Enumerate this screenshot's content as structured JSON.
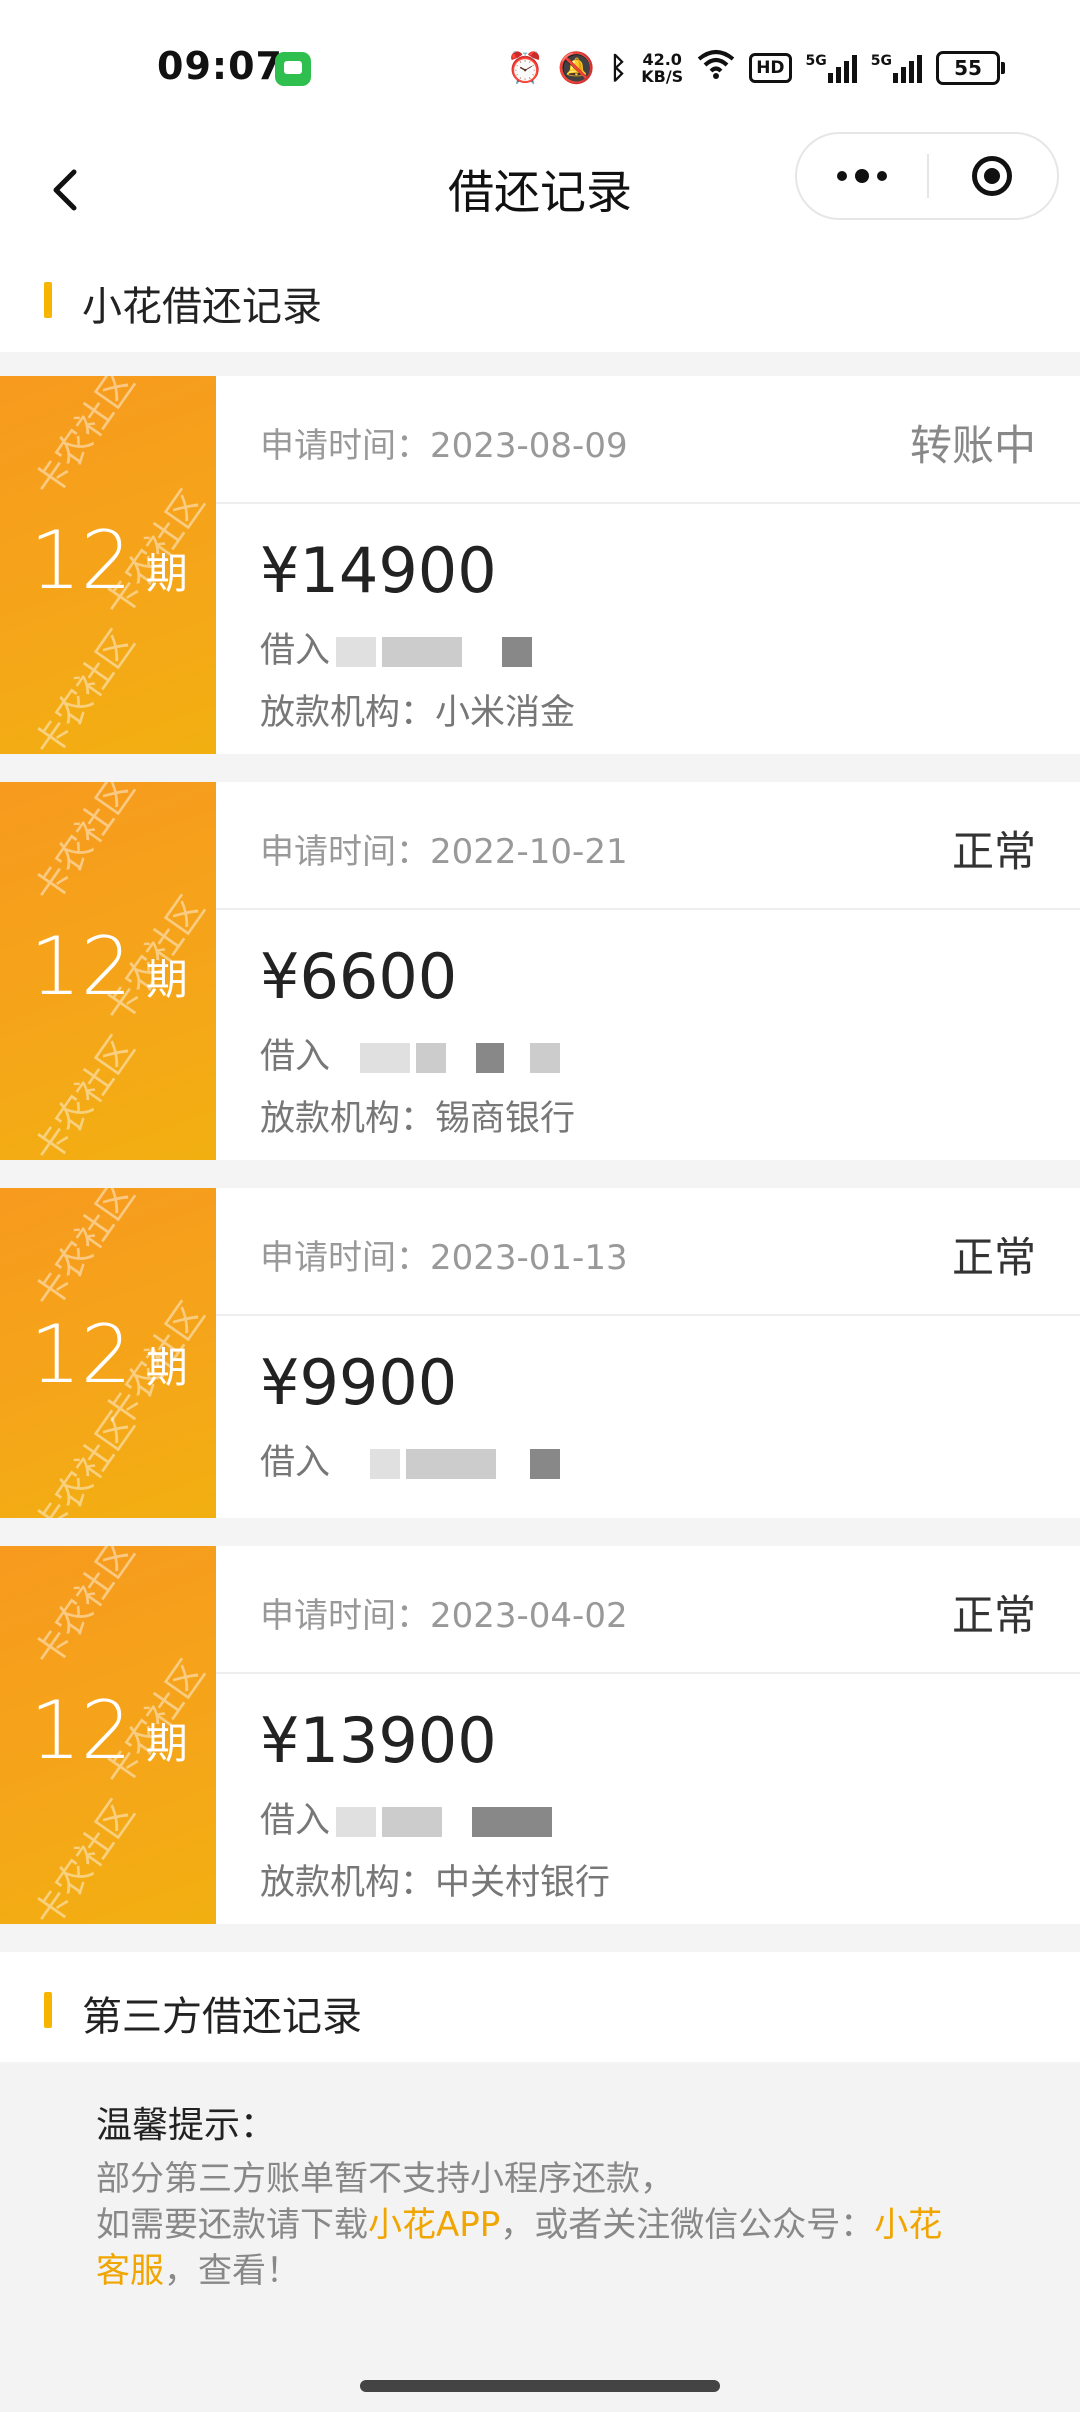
{
  "status_bar": {
    "time": "09:07",
    "network_speed_value": "42.0",
    "network_speed_unit": "KB/S",
    "hd_label": "HD",
    "signal1_label": "5G",
    "signal2_label": "5G",
    "battery": "55"
  },
  "nav": {
    "title": "借还记录"
  },
  "section1": {
    "title": "小花借还记录"
  },
  "loans": [
    {
      "period_num": "12",
      "period_unit": "期",
      "apply_label": "申请时间：",
      "apply_date": "2023-08-09",
      "status": "转账中",
      "amount": "¥14900",
      "borrow_prefix": "借入",
      "institution_label": "放款机构：",
      "institution": "小米消金"
    },
    {
      "period_num": "12",
      "period_unit": "期",
      "apply_label": "申请时间：",
      "apply_date": "2022-10-21",
      "status": "正常",
      "amount": "¥6600",
      "borrow_prefix": "借入",
      "institution_label": "放款机构：",
      "institution": "锡商银行"
    },
    {
      "period_num": "12",
      "period_unit": "期",
      "apply_label": "申请时间：",
      "apply_date": "2023-01-13",
      "status": "正常",
      "amount": "¥9900",
      "borrow_prefix": "借入"
    },
    {
      "period_num": "12",
      "period_unit": "期",
      "apply_label": "申请时间：",
      "apply_date": "2023-04-02",
      "status": "正常",
      "amount": "¥13900",
      "borrow_prefix": "借入",
      "institution_label": "放款机构：",
      "institution": "中关村银行"
    }
  ],
  "section2": {
    "title": "第三方借还记录"
  },
  "tips": {
    "title": "温馨提示：",
    "line1": "部分第三方账单暂不支持小程序还款，",
    "line2_prefix": "如需要还款请下载",
    "app_link": "小花APP",
    "line2_middle": "，或者关注微信公众号：",
    "service_link": "小花客服",
    "line2_suffix": "，查看！"
  },
  "watermark": "卡农社区",
  "colors": {
    "accent": "#f5b500",
    "card_gradient_start": "#f79a1e",
    "card_gradient_end": "#f2b010",
    "link": "#f0a500"
  }
}
